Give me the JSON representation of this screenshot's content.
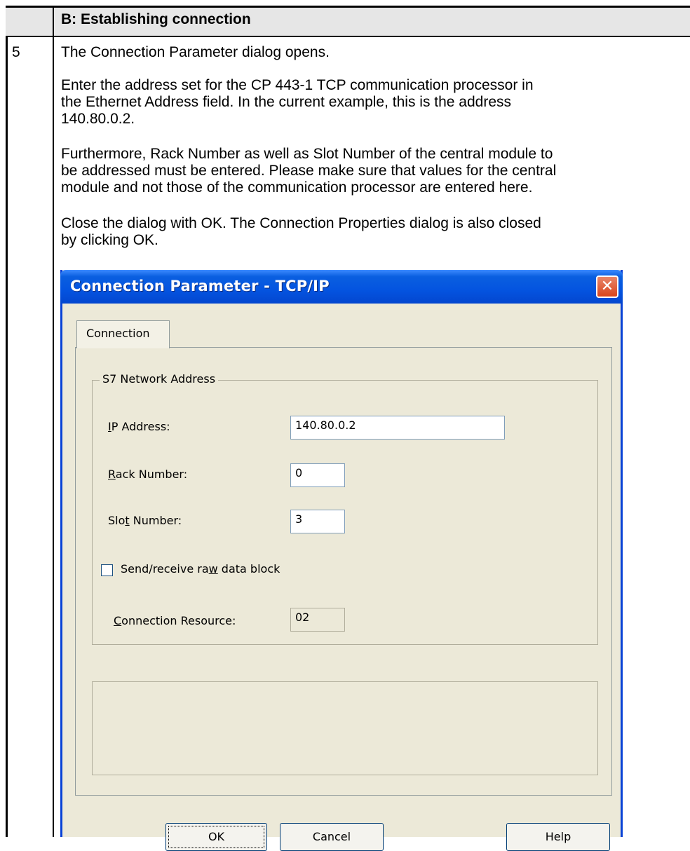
{
  "table": {
    "header": "B: Establishing connection",
    "step_number": "5",
    "paragraphs": [
      "The Connection Parameter dialog opens.",
      "Enter the address set for the CP 443-1 TCP communication processor in\nthe Ethernet Address field. In the current example, this is the address\n140.80.0.2.",
      "Furthermore, Rack Number as well as Slot Number of the central module to\nbe addressed must be entered. Please make sure that values for the central\nmodule and not those of the communication processor are entered here.",
      "Close the dialog with OK. The Connection Properties dialog is also closed\nby clicking OK."
    ]
  },
  "dialog": {
    "title": "Connection Parameter - TCP/IP",
    "close_icon": "close-icon",
    "tab_label": "Connection",
    "group_label": "S7 Network Address",
    "ip_label_pre": "",
    "ip_label_u": "I",
    "ip_label_post": "P Address:",
    "ip_value": "140.80.0.2",
    "rack_label_u": "R",
    "rack_label_post": "ack Number:",
    "rack_value": "0",
    "slot_label_pre": "Slo",
    "slot_label_u": "t",
    "slot_label_post": " Number:",
    "slot_value": "3",
    "checkbox_pre": "Send/receive ra",
    "checkbox_u": "w",
    "checkbox_post": " data block",
    "checkbox_checked": false,
    "resource_label_u": "C",
    "resource_label_post": "onnection Resource:",
    "resource_value": "02",
    "ok_label": "OK",
    "cancel_label": "Cancel",
    "help_label": "Help",
    "colors": {
      "titlebar": "#0454e0",
      "face": "#ece9d8",
      "close": "#d9441c"
    }
  }
}
